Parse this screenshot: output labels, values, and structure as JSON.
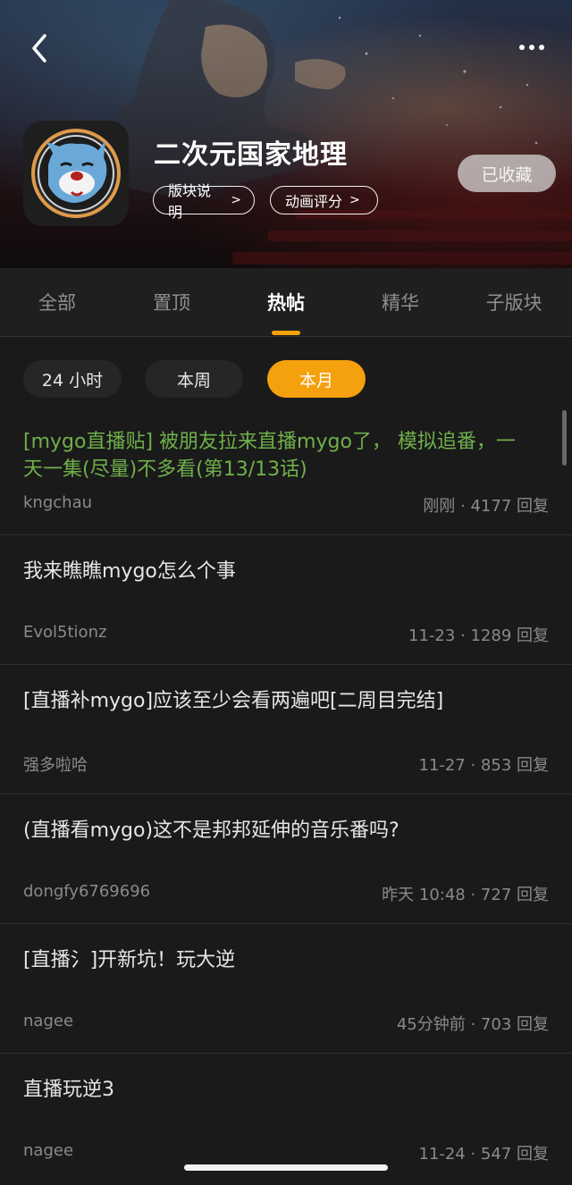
{
  "header": {
    "forum_title": "二次元国家地理",
    "info_button": "版块说明",
    "rating_button": "动画评分",
    "chevron": ">",
    "favorite_button": "已收藏"
  },
  "tabs": [
    {
      "label": "全部"
    },
    {
      "label": "置顶"
    },
    {
      "label": "热帖"
    },
    {
      "label": "精华"
    },
    {
      "label": "子版块"
    }
  ],
  "active_tab": "热帖",
  "filters": [
    {
      "label": "24 小时"
    },
    {
      "label": "本周"
    },
    {
      "label": "本月"
    }
  ],
  "active_filter": "本月",
  "posts": [
    {
      "title": "[mygo直播贴] 被朋友拉来直播mygo了， 模拟追番，一天一集(尽量)不多看(第13/13话)",
      "author": "kngchau",
      "meta": "刚刚 · 4177 回复"
    },
    {
      "title": "我来瞧瞧mygo怎么个事",
      "author": "Evol5tionz",
      "meta": "11-23 · 1289 回复"
    },
    {
      "title": "[直播补mygo]应该至少会看两遍吧[二周目完结]",
      "author": "强多啦哈",
      "meta": "11-27 · 853 回复"
    },
    {
      "title": "(直播看mygo)这不是邦邦延伸的音乐番吗?",
      "author": "dongfy6769696",
      "meta": "昨天 10:48 · 727 回复"
    },
    {
      "title": "[直播氵]开新坑！玩大逆",
      "author": "nagee",
      "meta": "45分钟前 · 703 回复"
    },
    {
      "title": "直播玩逆3",
      "author": "nagee",
      "meta": "11-24 · 547 回复"
    }
  ],
  "colors": {
    "accent": "#f5a00d",
    "pinned_title": "#6fb04a",
    "background": "#1a1a1a"
  }
}
